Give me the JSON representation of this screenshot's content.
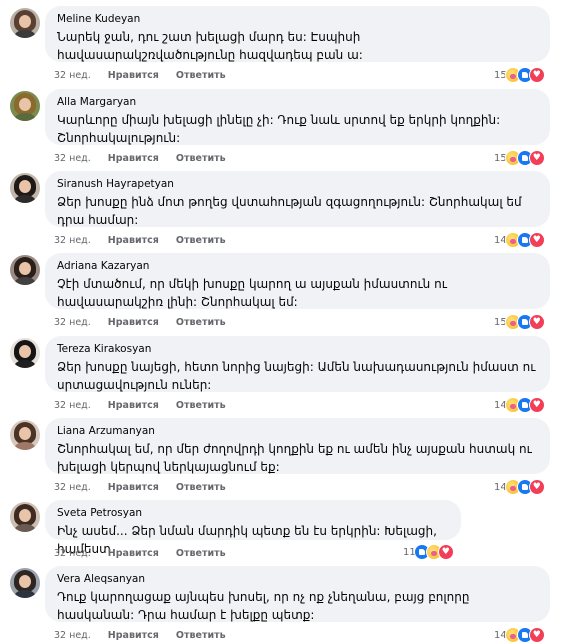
{
  "labels": {
    "like": "Нравится",
    "reply": "Ответить"
  },
  "comments": [
    {
      "author": "Meline Kudeyan",
      "text": "Նարեկ ջան, դու շատ խելացի մարդ ես: Էսպիսի հավասարակշռվածությունը հազվադեպ բան ա:",
      "time": "32 нед.",
      "reactions_count": "15",
      "reactions": [
        "care-icon",
        "like-icon",
        "love-icon"
      ]
    },
    {
      "author": "Alla Margaryan",
      "text": "Կարևորը միայն խելացի լինելը չի: Դուք նաև սրտով եք երկրի կողքին: Շնորհակալություն:",
      "time": "32 нед.",
      "reactions_count": "15",
      "reactions": [
        "care-icon",
        "like-icon",
        "love-icon"
      ]
    },
    {
      "author": "Siranush Hayrapetyan",
      "text": "Ձեր խոսքը ինձ մոտ թողեց վստահության զգացողություն: Շնորհակալ եմ դրա համար:",
      "time": "32 нед.",
      "reactions_count": "14",
      "reactions": [
        "care-icon",
        "like-icon",
        "love-icon"
      ]
    },
    {
      "author": "Adriana Kazaryan",
      "text": "Չէի մտածում, որ մեկի խոսքը կարող ա այսքան իմաստուն ու հավասարակշիռ լինի: Շնորհակալ եմ:",
      "time": "32 нед.",
      "reactions_count": "15",
      "reactions": [
        "care-icon",
        "like-icon",
        "love-icon"
      ]
    },
    {
      "author": "Tereza Kirakosyan",
      "text": "Ձեր խոսքը նայեցի, հետո նորից նայեցի: Ամեն նախադասություն իմաստ ու սրտացավություն ուներ:",
      "time": "32 нед.",
      "reactions_count": "14",
      "reactions": [
        "care-icon",
        "like-icon",
        "love-icon"
      ]
    },
    {
      "author": "Liana Arzumanyan",
      "text": "Շնորհակալ եմ, որ մեր ժողովրդի կողքին եք ու ամեն ինչ այսքան հստակ ու խելացի կերպով ներկայացնում եք:",
      "time": "32 нед.",
      "reactions_count": "14",
      "reactions": [
        "care-icon",
        "like-icon",
        "love-icon"
      ]
    },
    {
      "author": "Sveta Petrosyan",
      "text": "Ինչ ասեմ... Ձեր նման մարդիկ պետք են էս երկրին: Խելացի, համեստ",
      "time": "32 нед.",
      "reactions_count": "11",
      "reactions": [
        "like-icon",
        "care-icon",
        "love-icon"
      ]
    },
    {
      "author": "Vera Aleqsanyan",
      "text": "Դուք կարողացաք այնպես խոսել, որ ոչ ոք չնեղանա, բայց բոլորը հասկանան: Դրա համար է խելքը պետք:",
      "time": "32 нед.",
      "reactions_count": "14",
      "reactions": [
        "care-icon",
        "like-icon",
        "love-icon"
      ]
    }
  ],
  "avatars": [
    {
      "hair": "#5a4032",
      "body": "#3a3a3a",
      "bg": "#b9b0a6"
    },
    {
      "hair": "#8a6a2e",
      "body": "#5b6a3c",
      "bg": "#7b8d4e"
    },
    {
      "hair": "#1e1a18",
      "body": "#2b2b2b",
      "bg": "#c2b6a8"
    },
    {
      "hair": "#2a1f1b",
      "body": "#404040",
      "bg": "#9a8a84"
    },
    {
      "hair": "#151515",
      "body": "#202020",
      "bg": "#e6e0da"
    },
    {
      "hair": "#4a3426",
      "body": "#a07868",
      "bg": "#d7c8bd"
    },
    {
      "hair": "#3d2b22",
      "body": "#6a5b52",
      "bg": "#cdbfb2"
    },
    {
      "hair": "#2e2522",
      "body": "#2e3340",
      "bg": "#9aa3ad"
    }
  ]
}
